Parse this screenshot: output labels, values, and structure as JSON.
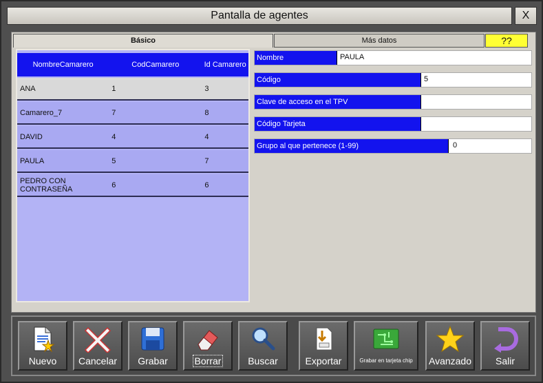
{
  "window": {
    "title": "Pantalla de agentes",
    "close_label": "X"
  },
  "tabs": {
    "basico": "Básico",
    "mas_datos": "Más datos",
    "help": "??"
  },
  "grid": {
    "headers": [
      "NombreCamarero",
      "CodCamarero",
      "Id Camarero"
    ],
    "rows": [
      {
        "nombre": "ANA",
        "cod": "1",
        "id": "3"
      },
      {
        "nombre": "Camarero_7",
        "cod": "7",
        "id": "8"
      },
      {
        "nombre": "DAVID",
        "cod": "4",
        "id": "4"
      },
      {
        "nombre": "PAULA",
        "cod": "5",
        "id": "7"
      },
      {
        "nombre": "PEDRO CON CONTRASEÑA",
        "cod": "6",
        "id": "6"
      }
    ]
  },
  "form": {
    "nombre": {
      "label": "Nombre",
      "value": "PAULA"
    },
    "codigo": {
      "label": "Código",
      "value": "5"
    },
    "clave": {
      "label": "Clave de acceso en el TPV",
      "value": ""
    },
    "tarjeta": {
      "label": "Código Tarjeta",
      "value": ""
    },
    "grupo": {
      "label": "Grupo al que pertenece (1-99)",
      "value": "0"
    }
  },
  "toolbar": {
    "nuevo": "Nuevo",
    "cancelar": "Cancelar",
    "grabar": "Grabar",
    "borrar": "Borrar",
    "buscar": "Buscar",
    "exportar": "Exportar",
    "grabar_chip": "Grabar en tarjeta chip",
    "avanzado": "Avanzado",
    "salir": "Salir"
  },
  "colors": {
    "accent": "#1313ee",
    "grid_bg": "#b3b3f5",
    "help_bg": "#ffff33"
  }
}
